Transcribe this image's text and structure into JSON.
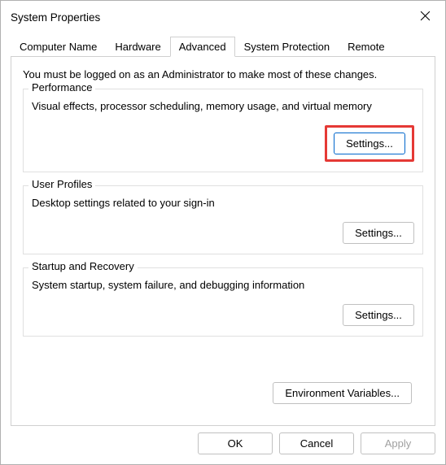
{
  "window": {
    "title": "System Properties"
  },
  "tabs": {
    "items": [
      {
        "label": "Computer Name"
      },
      {
        "label": "Hardware"
      },
      {
        "label": "Advanced"
      },
      {
        "label": "System Protection"
      },
      {
        "label": "Remote"
      }
    ],
    "activeIndex": 2
  },
  "intro": "You must be logged on as an Administrator to make most of these changes.",
  "groups": {
    "performance": {
      "title": "Performance",
      "desc": "Visual effects, processor scheduling, memory usage, and virtual memory",
      "button": "Settings..."
    },
    "userProfiles": {
      "title": "User Profiles",
      "desc": "Desktop settings related to your sign-in",
      "button": "Settings..."
    },
    "startupRecovery": {
      "title": "Startup and Recovery",
      "desc": "System startup, system failure, and debugging information",
      "button": "Settings..."
    }
  },
  "envVars": {
    "button": "Environment Variables..."
  },
  "dialog": {
    "ok": "OK",
    "cancel": "Cancel",
    "apply": "Apply"
  }
}
